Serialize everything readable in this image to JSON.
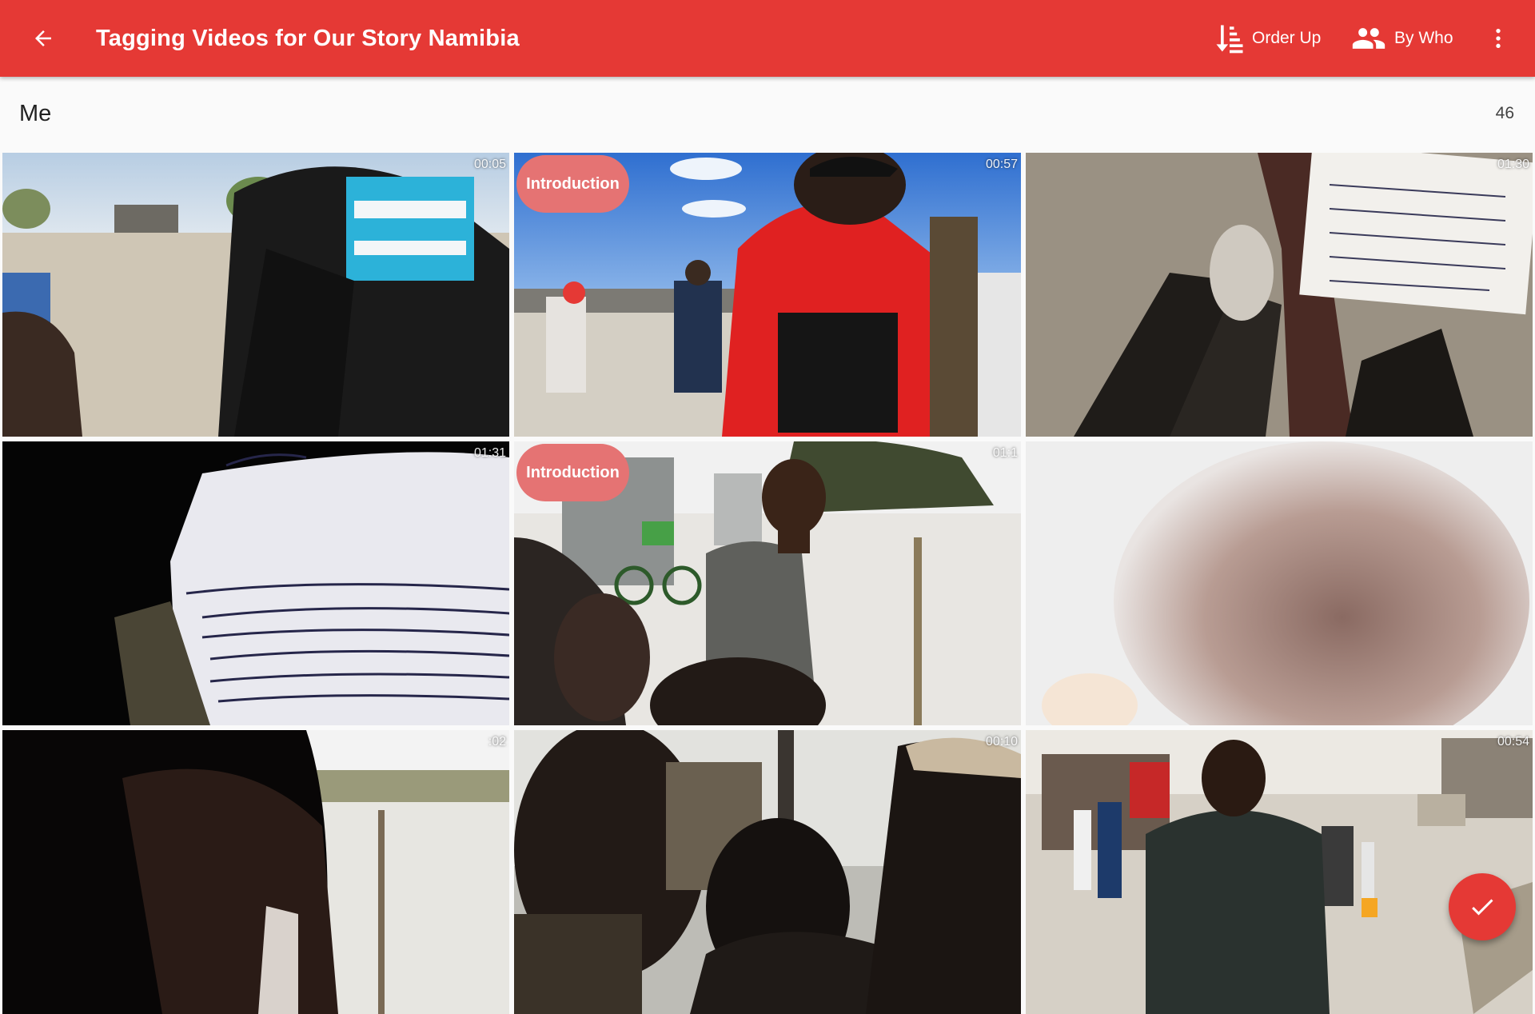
{
  "appbar": {
    "title": "Tagging Videos for Our Story Namibia",
    "back_icon": "arrow-back-icon",
    "actions": [
      {
        "label": "Order Up",
        "icon": "sort-order-icon"
      },
      {
        "label": "By Who",
        "icon": "people-icon"
      }
    ],
    "overflow_icon": "more-vert-icon"
  },
  "section": {
    "title": "Me",
    "count": "46"
  },
  "videos": [
    {
      "duration": "00:05",
      "tag": ""
    },
    {
      "duration": "00:57",
      "tag": "Introduction"
    },
    {
      "duration": "01:30",
      "tag": ""
    },
    {
      "duration": "01:31",
      "tag": ""
    },
    {
      "duration": "01:1",
      "tag": "Introduction"
    },
    {
      "duration": "",
      "tag": ""
    },
    {
      "duration": ":02",
      "tag": ""
    },
    {
      "duration": "00:10",
      "tag": ""
    },
    {
      "duration": "00:54",
      "tag": ""
    }
  ],
  "fab": {
    "icon": "check-icon"
  },
  "colors": {
    "primary": "#e53935",
    "chip": "#e57373",
    "background": "#fafafa"
  }
}
